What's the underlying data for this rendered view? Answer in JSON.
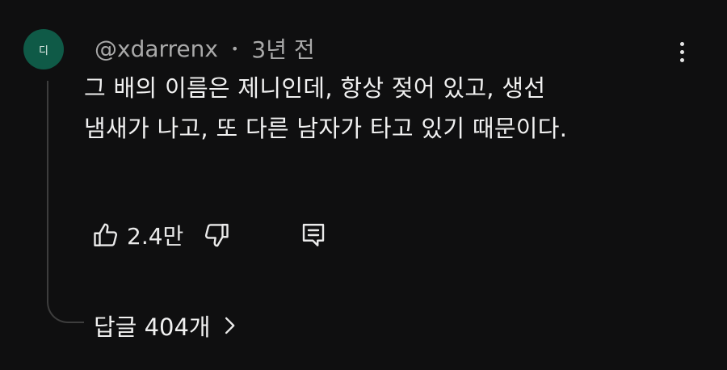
{
  "comment": {
    "avatar_letter": "디",
    "author": "@xdarrenx",
    "separator": "•",
    "time": "3년 전",
    "text_line1": "그 배의 이름은 제니인데, 항상 젖어 있고, 생선",
    "text_line2": "냄새가 나고, 또 다른 남자가 타고 있기 때문이다.",
    "like_count": "2.4만",
    "replies_label": "답글 404개"
  },
  "icons": {
    "like": "thumbs-up-icon",
    "dislike": "thumbs-down-icon",
    "reply": "comment-reply-icon",
    "more": "more-vertical-icon",
    "replies": "chevron-right-icon"
  },
  "colors": {
    "background": "#0f0f10",
    "avatar": "#0f5a47",
    "text": "#f1f1f1",
    "meta_text": "#a9a9a9"
  }
}
